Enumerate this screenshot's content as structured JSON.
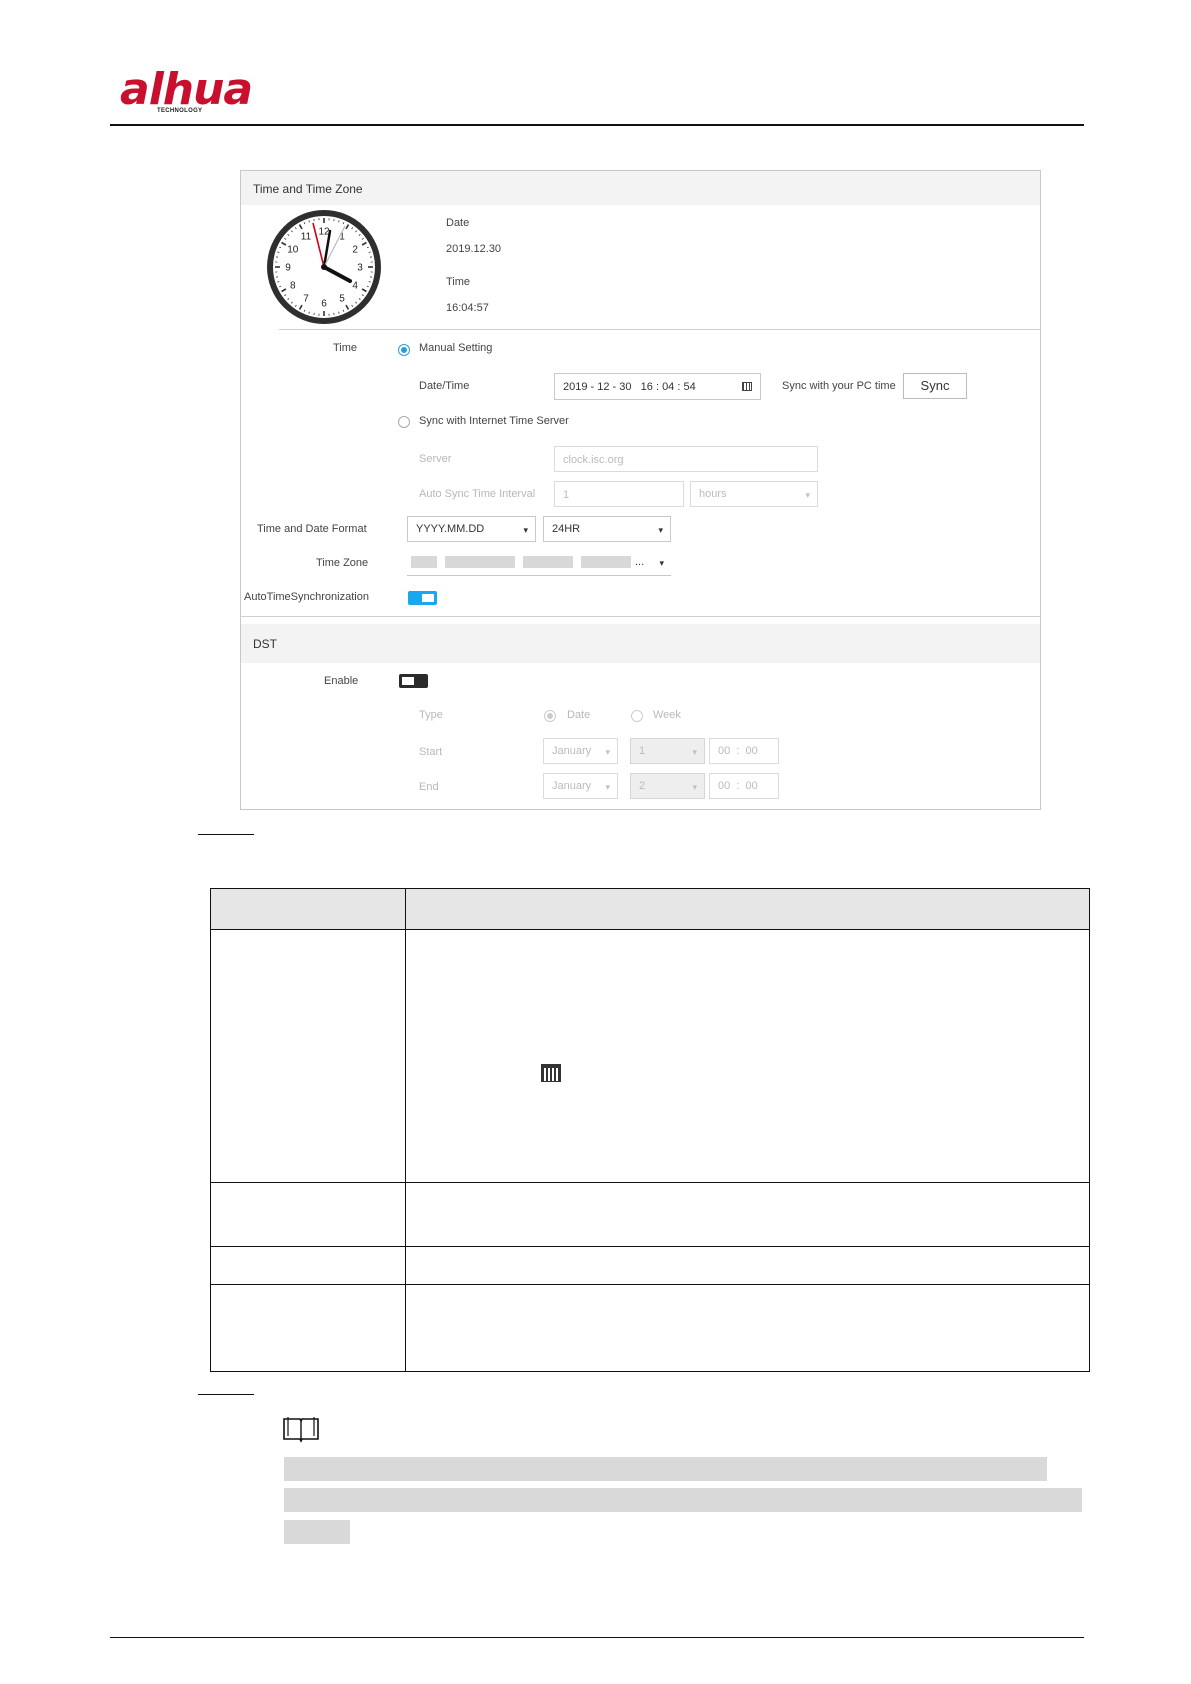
{
  "header": {
    "brand": "alhua",
    "brand_sub": "TECHNOLOGY"
  },
  "colors": {
    "brand": "#c8102e",
    "accent": "#1aa7f0"
  },
  "panel": {
    "time_zone_section": {
      "title": "Time and Time Zone"
    },
    "clock": {
      "numbers": [
        "12",
        "1",
        "2",
        "3",
        "4",
        "5",
        "6",
        "7",
        "8",
        "9",
        "10",
        "11"
      ],
      "date_label": "Date",
      "date_value": "2019.12.30",
      "time_label": "Time",
      "time_value": "16:04:57"
    },
    "time": {
      "label": "Time",
      "manual_setting": "Manual Setting",
      "datetime_label": "Date/Time",
      "datetime_value": "2019 - 12 - 30   16 : 04 : 54",
      "sync_pc_label": "Sync with your PC time",
      "sync_button": "Sync",
      "internet_sync": "Sync with Internet Time Server",
      "server_label": "Server",
      "server_value": "clock.isc.org",
      "interval_label": "Auto Sync Time Interval",
      "interval_value": "1",
      "interval_unit": "hours"
    },
    "format": {
      "label": "Time and Date Format",
      "date_format": "YYYY.MM.DD",
      "hour_format": "24HR"
    },
    "zone": {
      "label": "Time Zone",
      "value": "..."
    },
    "auto_sync": {
      "label": "AutoTimeSynchronization"
    },
    "dst": {
      "title": "DST",
      "enable_label": "Enable",
      "type_label": "Type",
      "type_date": "Date",
      "type_week": "Week",
      "start_label": "Start",
      "start_month": "January",
      "start_day": "1",
      "start_time": "00  :  00",
      "end_label": "End",
      "end_month": "January",
      "end_day": "2",
      "end_time": "00  :  00"
    }
  }
}
